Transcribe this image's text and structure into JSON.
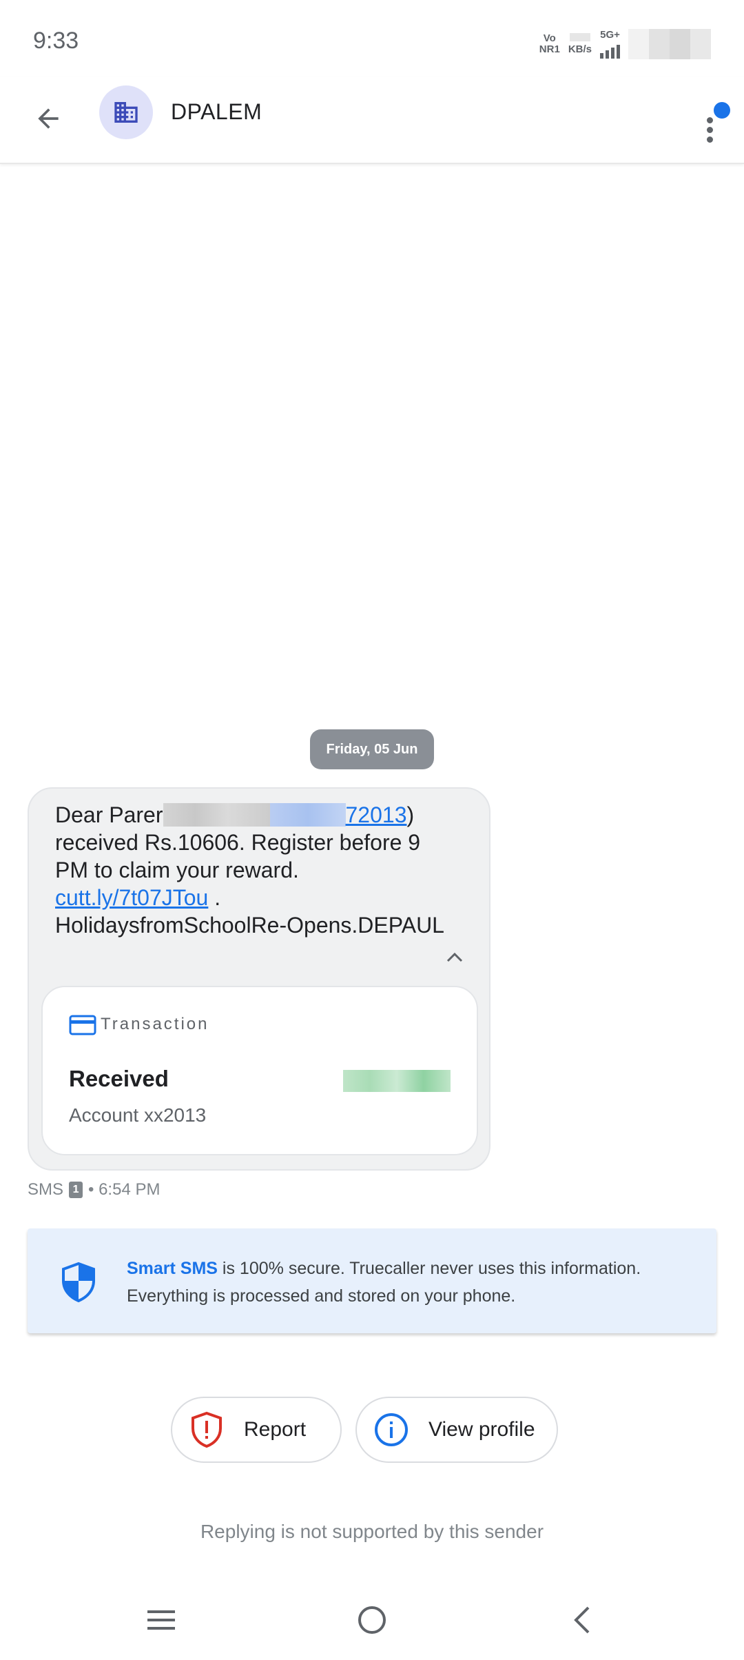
{
  "status_bar": {
    "time": "9:33",
    "volte_top": "Vo",
    "volte_bottom": "NR1",
    "speed_unit": "KB/s",
    "network": "5G+"
  },
  "header": {
    "contact_name": "DPALEM",
    "avatar_icon": "building-icon",
    "unread_indicator_color": "#1a73e8"
  },
  "conversation": {
    "date_label": "Friday, 05 Jun",
    "message": {
      "text_start": "Dear Parer",
      "link_suffix": "72013",
      "close_paren": ")",
      "text_main": " received Rs.10606. Register before 9 PM to claim your reward. ",
      "link_url": "cutt.ly/7t07JTou",
      "text_end": " . HolidaysfromSchoolRe-Opens.DEPAUL"
    },
    "transaction": {
      "label": "Transaction",
      "title": "Received",
      "account": "Account xx2013"
    },
    "meta": {
      "channel": "SMS",
      "sim": "1",
      "time": "• 6:54 PM"
    }
  },
  "smart_sms": {
    "brand": "Smart SMS",
    "text": " is 100% secure. Truecaller never uses this information. Everything is processed and stored on your phone."
  },
  "actions": {
    "report_label": "Report",
    "view_profile_label": "View profile"
  },
  "reply_note": "Replying is not supported by this sender",
  "colors": {
    "accent": "#1a73e8",
    "report_red": "#d93025"
  }
}
